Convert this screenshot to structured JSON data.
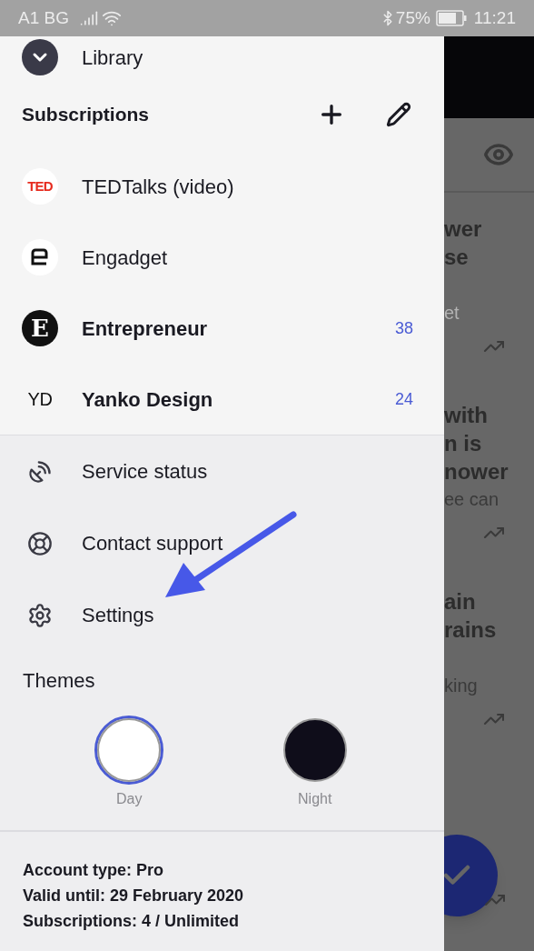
{
  "status_bar": {
    "carrier": "A1 BG",
    "battery": "75%",
    "time": "11:21"
  },
  "drawer": {
    "library": {
      "label": "Library"
    },
    "subscriptions": {
      "title": "Subscriptions",
      "items": [
        {
          "name": "TEDTalks (video)",
          "logo": "TED",
          "kind": "ted",
          "unread": false
        },
        {
          "name": "Engadget",
          "kind": "engadget",
          "unread": false
        },
        {
          "name": "Entrepreneur",
          "logo": "E",
          "kind": "entrepreneur",
          "unread": true,
          "count": "38"
        },
        {
          "name": "Yanko Design",
          "logo": "YD",
          "kind": "yanko",
          "unread": true,
          "count": "24"
        }
      ]
    },
    "menu": [
      {
        "label": "Service status",
        "kind": "satellite"
      },
      {
        "label": "Contact support",
        "kind": "lifebuoy"
      },
      {
        "label": "Settings",
        "kind": "settings"
      }
    ],
    "themes": {
      "title": "Themes",
      "options": [
        {
          "label": "Day",
          "color": "#ffffff",
          "selected": true
        },
        {
          "label": "Night",
          "color": "#0f0d1a",
          "selected": false
        }
      ]
    },
    "account": [
      "Account type: Pro",
      "Valid until: 29 February 2020",
      "Subscriptions: 4 / Unlimited"
    ]
  },
  "background": {
    "cards": [
      {
        "title": [
          "wer",
          "se"
        ],
        "sub": "et",
        "faint": true
      },
      {
        "title": [
          "with",
          "n is",
          "nower"
        ],
        "sub": "ee can",
        "faint": false
      },
      {
        "title": [
          "ain",
          "rains"
        ],
        "sub": "king",
        "faint": false
      }
    ]
  }
}
